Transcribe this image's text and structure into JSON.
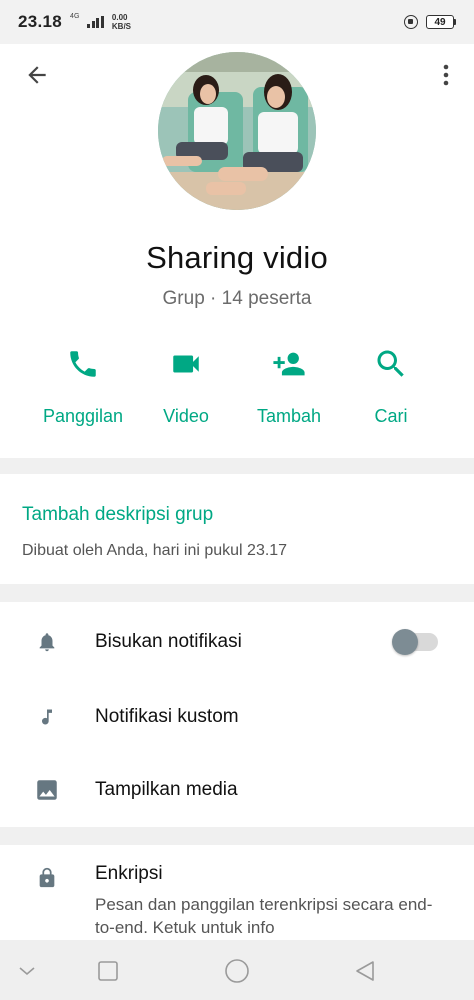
{
  "status_bar": {
    "time": "23.18",
    "network_type": "4G",
    "speed_value": "0.00",
    "speed_unit": "KB/S",
    "battery_level": "49"
  },
  "header": {
    "group_name": "Sharing vidio",
    "subtitle": "Grup · 14 peserta"
  },
  "actions": [
    {
      "label": "Panggilan",
      "icon": "phone-icon"
    },
    {
      "label": "Video",
      "icon": "videocam-icon"
    },
    {
      "label": "Tambah",
      "icon": "person-add-icon"
    },
    {
      "label": "Cari",
      "icon": "search-icon"
    }
  ],
  "description": {
    "add_label": "Tambah deskripsi grup",
    "created_info": "Dibuat oleh Anda, hari ini pukul 23.17"
  },
  "settings": {
    "mute_label": "Bisukan notifikasi",
    "mute_enabled": false,
    "custom_notif_label": "Notifikasi kustom",
    "media_label": "Tampilkan media"
  },
  "encryption": {
    "title": "Enkripsi",
    "description": "Pesan dan panggilan terenkripsi secara end-to-end. Ketuk untuk info"
  },
  "colors": {
    "accent": "#00a884",
    "icon_gray": "#667781",
    "background": "#f0f0f0"
  }
}
